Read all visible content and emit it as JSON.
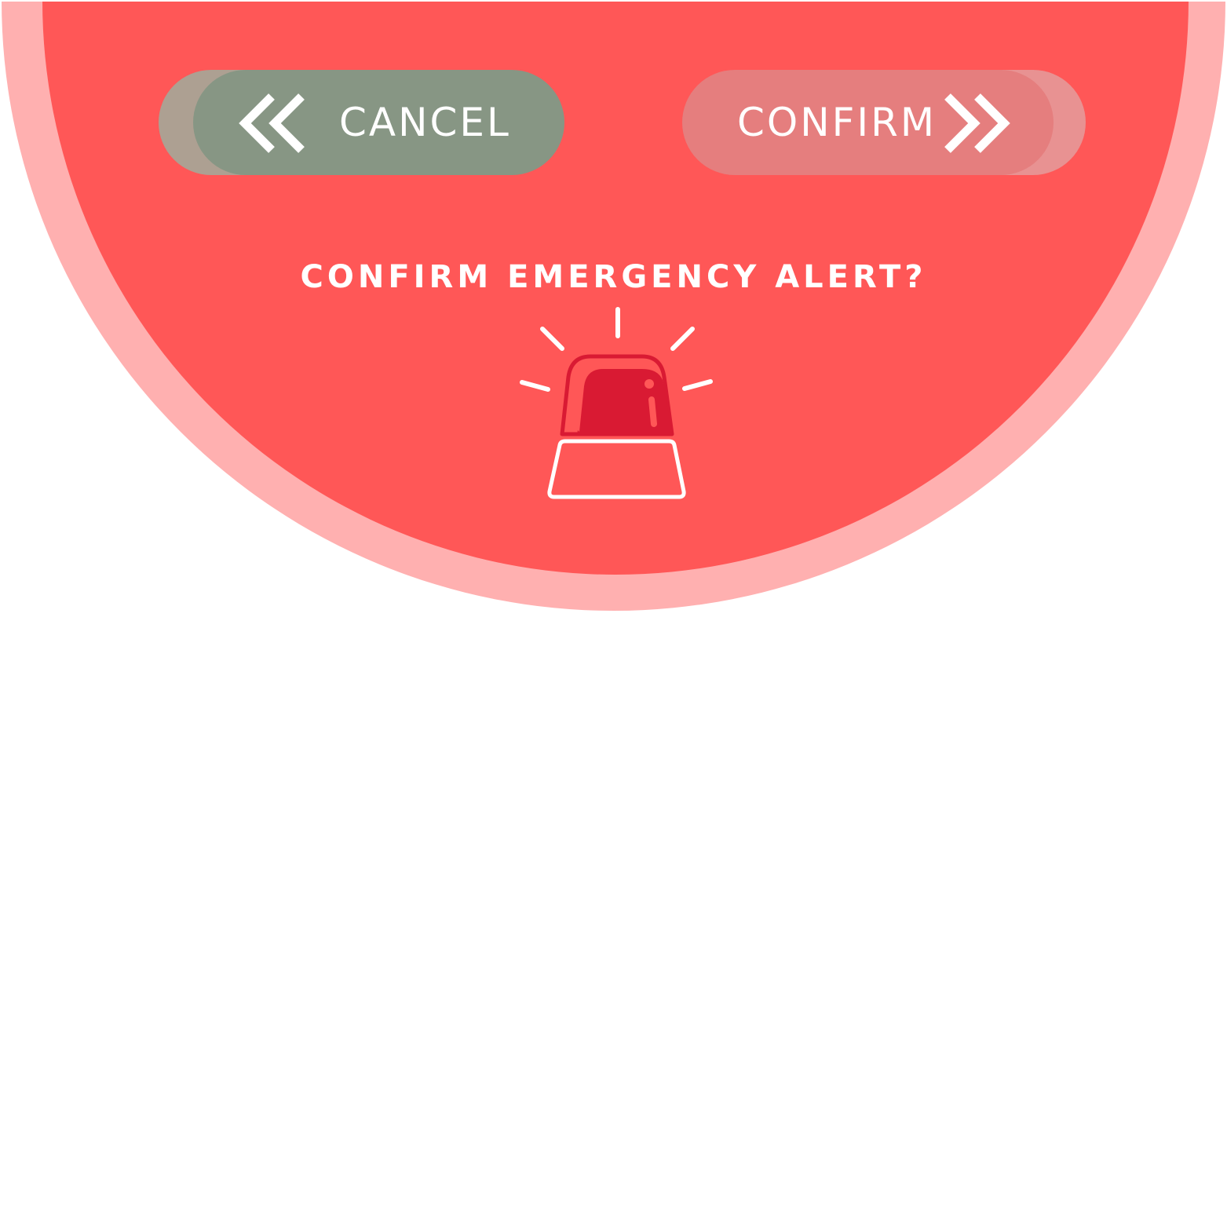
{
  "dialog": {
    "prompt": "CONFIRM EMERGENCY ALERT?",
    "icon": "emergency-siren-icon"
  },
  "buttons": {
    "cancel": {
      "label": "CANCEL",
      "icon": "chevron-double-left-icon"
    },
    "confirm": {
      "label": "CONFIRM",
      "icon": "chevron-double-right-icon"
    }
  },
  "colors": {
    "panel": "#ff5757",
    "panel_halo": "#ffb0b0",
    "cancel_button": "#879684",
    "cancel_button_shadow": "#ada092",
    "confirm_button": "#e57e7e",
    "confirm_button_shadow": "#e89292",
    "siren_dome": "#d91a33",
    "text": "#ffffff"
  }
}
